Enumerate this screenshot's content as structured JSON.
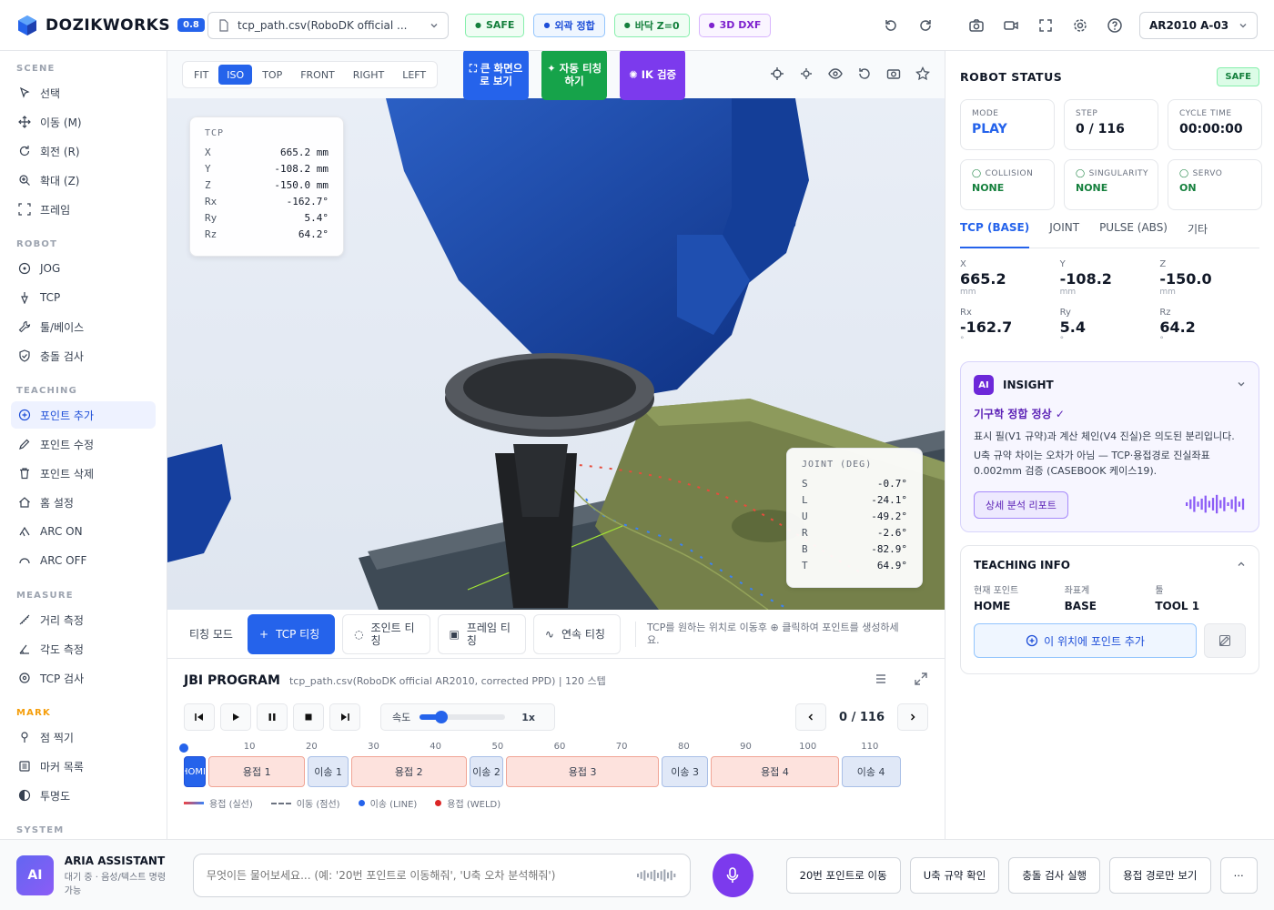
{
  "topbar": {
    "brand": "DOZIKWORKS",
    "version": "0.8",
    "file": "tcp_path.csv(RoboDK official ...",
    "chips": [
      {
        "label": "SAFE",
        "icon": "shield-icon",
        "fg": "#15803d",
        "bg": "#f0fdf4",
        "border": "#86efac"
      },
      {
        "label": "외곽 정합",
        "icon": "target-icon",
        "fg": "#1d4ed8",
        "bg": "#eff6ff",
        "border": "#93c5fd"
      },
      {
        "label": "바닥 Z=0",
        "icon": "download-icon",
        "fg": "#15803d",
        "bg": "#f0fdf4",
        "border": "#86efac"
      },
      {
        "label": "3D DXF",
        "icon": "layers-icon",
        "fg": "#7e22ce",
        "bg": "#faf5ff",
        "border": "#d8b4fe"
      }
    ],
    "robot": "AR2010 A-03"
  },
  "sidebar": {
    "sections": [
      {
        "title": "SCENE",
        "style": "normal",
        "items": [
          {
            "label": "선택",
            "icon": "pointer-icon"
          },
          {
            "label": "이동 (M)",
            "icon": "move-icon"
          },
          {
            "label": "회전 (R)",
            "icon": "rotate-icon"
          },
          {
            "label": "확대 (Z)",
            "icon": "zoom-icon"
          },
          {
            "label": "프레임",
            "icon": "frame-icon"
          }
        ]
      },
      {
        "title": "ROBOT",
        "style": "normal",
        "items": [
          {
            "label": "JOG",
            "icon": "jog-icon"
          },
          {
            "label": "TCP",
            "icon": "tcp-icon"
          },
          {
            "label": "툴/베이스",
            "icon": "wrench-icon"
          },
          {
            "label": "충돌 검사",
            "icon": "shield-check-icon"
          }
        ]
      },
      {
        "title": "TEACHING",
        "style": "normal",
        "items": [
          {
            "label": "포인트 추가",
            "icon": "plus-circle-icon",
            "active": true
          },
          {
            "label": "포인트 수정",
            "icon": "edit-icon"
          },
          {
            "label": "포인트 삭제",
            "icon": "trash-icon"
          },
          {
            "label": "홈 설정",
            "icon": "home-icon"
          },
          {
            "label": "ARC ON",
            "icon": "arc-on-icon"
          },
          {
            "label": "ARC OFF",
            "icon": "arc-off-icon"
          }
        ]
      },
      {
        "title": "MEASURE",
        "style": "normal",
        "items": [
          {
            "label": "거리 측정",
            "icon": "ruler-icon"
          },
          {
            "label": "각도 측정",
            "icon": "angle-icon"
          },
          {
            "label": "TCP 검사",
            "icon": "crosshair-icon"
          }
        ]
      },
      {
        "title": "MARK",
        "style": "mark",
        "items": [
          {
            "label": "점 찍기",
            "icon": "pin-icon"
          },
          {
            "label": "마커 목록",
            "icon": "list-icon"
          },
          {
            "label": "투명도",
            "icon": "opacity-icon"
          }
        ]
      },
      {
        "title": "SYSTEM",
        "style": "normal",
        "items": []
      }
    ]
  },
  "viewport": {
    "views": [
      "FIT",
      "ISO",
      "TOP",
      "FRONT",
      "RIGHT",
      "LEFT"
    ],
    "active_view": "ISO",
    "big_buttons": [
      {
        "label": "⛶ 큰 화면으로 보기",
        "color": "#2563eb"
      },
      {
        "label": "✦ 자동 티칭하기",
        "color": "#16a34a"
      },
      {
        "label": "✺ IK 검증",
        "color": "#7c3aed"
      }
    ],
    "tcp_overlay": {
      "title": "TCP",
      "rows": [
        {
          "k": "X",
          "v": "665.2 mm"
        },
        {
          "k": "Y",
          "v": "-108.2 mm"
        },
        {
          "k": "Z",
          "v": "-150.0 mm"
        },
        {
          "k": "Rx",
          "v": "-162.7°"
        },
        {
          "k": "Ry",
          "v": "5.4°"
        },
        {
          "k": "Rz",
          "v": "64.2°"
        }
      ]
    },
    "joint_overlay": {
      "title": "JOINT (DEG)",
      "rows": [
        {
          "k": "S",
          "v": "-0.7°"
        },
        {
          "k": "L",
          "v": "-24.1°"
        },
        {
          "k": "U",
          "v": "-49.2°"
        },
        {
          "k": "R",
          "v": "-2.6°"
        },
        {
          "k": "B",
          "v": "-82.9°"
        },
        {
          "k": "T",
          "v": "64.9°"
        }
      ]
    }
  },
  "teach_bar": {
    "mode_label": "티칭 모드",
    "modes": [
      {
        "label": "TCP 티칭",
        "icon": "+",
        "active": true
      },
      {
        "label": "조인트 티칭",
        "icon": "◌"
      },
      {
        "label": "프레임 티칭",
        "icon": "▣"
      },
      {
        "label": "연속 티칭",
        "icon": "∿"
      }
    ],
    "hint": "TCP를 원하는 위치로 이동후 ⊕ 클릭하여 포인트를 생성하세요."
  },
  "program": {
    "title": "JBI PROGRAM",
    "subtitle": "tcp_path.csv(RoboDK official AR2010, corrected PPD) | 120 스텝",
    "speed_label": "속도",
    "speed_value": "1x",
    "speed_fraction": 0.25,
    "step_counter": "0 / 116",
    "total_steps": 120,
    "ticks": [
      10,
      20,
      30,
      40,
      50,
      60,
      70,
      80,
      90,
      100,
      110
    ],
    "segments": [
      {
        "label": "HOME",
        "start": 0,
        "end": 4,
        "kind": "home"
      },
      {
        "label": "용접 1",
        "start": 4,
        "end": 20,
        "kind": "weld"
      },
      {
        "label": "이송 1",
        "start": 20,
        "end": 27,
        "kind": "move"
      },
      {
        "label": "용접 2",
        "start": 27,
        "end": 46,
        "kind": "weld"
      },
      {
        "label": "이송 2",
        "start": 46,
        "end": 52,
        "kind": "move"
      },
      {
        "label": "용접 3",
        "start": 52,
        "end": 77,
        "kind": "weld"
      },
      {
        "label": "이송 3",
        "start": 77,
        "end": 85,
        "kind": "move"
      },
      {
        "label": "용접 4",
        "start": 85,
        "end": 106,
        "kind": "weld"
      },
      {
        "label": "이송 4",
        "start": 106,
        "end": 116,
        "kind": "move"
      }
    ],
    "legend": [
      {
        "label": "용접 (실선)",
        "kind": "solid"
      },
      {
        "label": "이동 (점선)",
        "kind": "dash"
      },
      {
        "label": "이송 (LINE)",
        "kind": "blue-dot"
      },
      {
        "label": "용접 (WELD)",
        "kind": "red-dot"
      }
    ]
  },
  "status": {
    "title": "ROBOT STATUS",
    "badge": "SAFE",
    "cards": [
      {
        "label": "MODE",
        "value": "PLAY",
        "color": "#2563eb",
        "icon": ""
      },
      {
        "label": "STEP",
        "value": "0 / 116",
        "color": "#111827",
        "icon": ""
      },
      {
        "label": "CYCLE TIME",
        "value": "00:00:00",
        "color": "#111827",
        "icon": ""
      },
      {
        "label": "COLLISION",
        "value": "NONE",
        "color": "#15803d",
        "icon": "shield-icon"
      },
      {
        "label": "SINGULARITY",
        "value": "NONE",
        "color": "#15803d",
        "icon": "clock-icon"
      },
      {
        "label": "SERVO",
        "value": "ON",
        "color": "#15803d",
        "icon": "power-icon"
      }
    ],
    "tabs": [
      "TCP (BASE)",
      "JOINT",
      "PULSE (ABS)",
      "기타"
    ],
    "active_tab": "TCP (BASE)",
    "coords": [
      {
        "k": "X",
        "v": "665.2",
        "u": "mm"
      },
      {
        "k": "Y",
        "v": "-108.2",
        "u": "mm"
      },
      {
        "k": "Z",
        "v": "-150.0",
        "u": "mm"
      },
      {
        "k": "Rx",
        "v": "-162.7",
        "u": "°"
      },
      {
        "k": "Ry",
        "v": "5.4",
        "u": "°"
      },
      {
        "k": "Rz",
        "v": "64.2",
        "u": "°"
      }
    ]
  },
  "insight": {
    "badge": "AI",
    "title": "INSIGHT",
    "status": "기구학 정합 정상 ✓",
    "text1": "표시 필(V1 규약)과 계산 체인(V4 진실)은 의도된 분리입니다.",
    "text2": "U축 규약 차이는 오차가 아님 — TCP·용접경로 진실좌표 0.002mm 검증 (CASEBOOK 케이스19).",
    "button": "상세 분석 리포트"
  },
  "teaching_info": {
    "title": "TEACHING INFO",
    "fields": [
      {
        "k": "현재 포인트",
        "v": "HOME"
      },
      {
        "k": "좌표계",
        "v": "BASE"
      },
      {
        "k": "툴",
        "v": "TOOL 1"
      }
    ],
    "add_button": "이 위치에 포인트 추가"
  },
  "assistant": {
    "avatar": "AI",
    "name": "ARIA ASSISTANT",
    "status": "대기 중 · 음성/텍스트 명령 가능",
    "placeholder": "무엇이든 물어보세요... (예: '20번 포인트로 이동해줘', 'U축 오차 분석해줘')",
    "quick": [
      "20번 포인트로 이동",
      "U축 규약 확인",
      "충돌 검사 실행",
      "용접 경로만 보기",
      "⋯"
    ]
  }
}
